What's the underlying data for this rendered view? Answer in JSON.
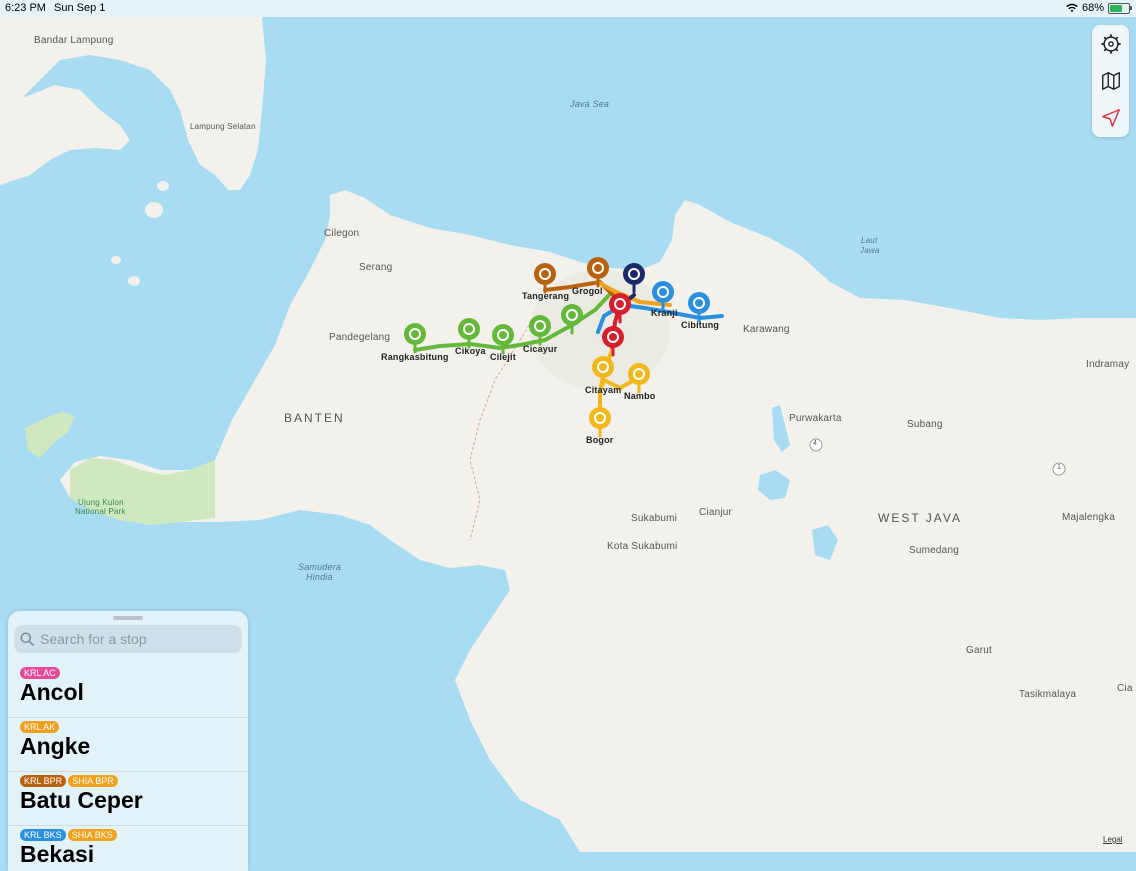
{
  "status_bar": {
    "time": "6:23 PM",
    "date": "Sun Sep 1",
    "battery": "68%",
    "battery_level": 0.68
  },
  "toolbar": {
    "icons": [
      "settings-gear-icon",
      "map-icon",
      "location-arrow-icon"
    ]
  },
  "map": {
    "labels": {
      "bandar_lampung": "Bandar Lampung",
      "lampung_selatan": "Lampung Selatan",
      "java_sea": "Java Sea",
      "cilegon": "Cilegon",
      "serang": "Serang",
      "pandegelang": "Pandegelang",
      "laut_jawa_1": "Laut",
      "laut_jawa_2": "Jawa",
      "karawang": "Karawang",
      "indramayu": "Indramay",
      "banten": "BANTEN",
      "purwakarta": "Purwakarta",
      "subang": "Subang",
      "ujung_kulon_1": "Ujung Kulon",
      "ujung_kulon_2": "National Park",
      "sukabumi": "Sukabumi",
      "cianjur": "Cianjur",
      "west_java": "WEST JAVA",
      "majalengka": "Majalengka",
      "kota_sukabumi": "Kota Sukabumi",
      "sumedang": "Sumedang",
      "samudera_1": "Samudera",
      "samudera_2": "Hindia",
      "garut": "Garut",
      "tasikmalaya": "Tasikmalaya",
      "ciamis": "Cia",
      "road_4": "4",
      "road_1": "1"
    },
    "stops": {
      "tangerang": "Tangerang",
      "grogol": "Grogol",
      "kranji": "Kranji",
      "cibitung": "Cibitung",
      "rangkasbitung": "Rangkasbitung",
      "cikoya": "Cikoya",
      "cilejit": "Cilejit",
      "cicayur": "Cicayur",
      "citayam": "Citayam",
      "nambo": "Nambo",
      "bogor": "Bogor"
    },
    "legal": "Legal"
  },
  "colors": {
    "green": "#64b83a",
    "brown": "#b9620e",
    "navy": "#1c2a6b",
    "red": "#d61f2c",
    "blue": "#2b8fe0",
    "yellow": "#f2b81b",
    "pink": "#e64b9a",
    "orange": "#f0a21c"
  },
  "search": {
    "placeholder": "Search for a stop"
  },
  "stop_list": [
    {
      "name": "Ancol",
      "badges": [
        {
          "label": "KRL AC",
          "color": "#e64b9a"
        }
      ]
    },
    {
      "name": "Angke",
      "badges": [
        {
          "label": "KRL AK",
          "color": "#f0a21c"
        }
      ]
    },
    {
      "name": "Batu Ceper",
      "badges": [
        {
          "label": "KRL BPR",
          "color": "#b9620e"
        },
        {
          "label": "SHIA BPR",
          "color": "#f0a21c"
        }
      ]
    },
    {
      "name": "Bekasi",
      "badges": [
        {
          "label": "KRL BKS",
          "color": "#2b8fe0"
        },
        {
          "label": "SHIA BKS",
          "color": "#f0a21c"
        }
      ]
    }
  ]
}
